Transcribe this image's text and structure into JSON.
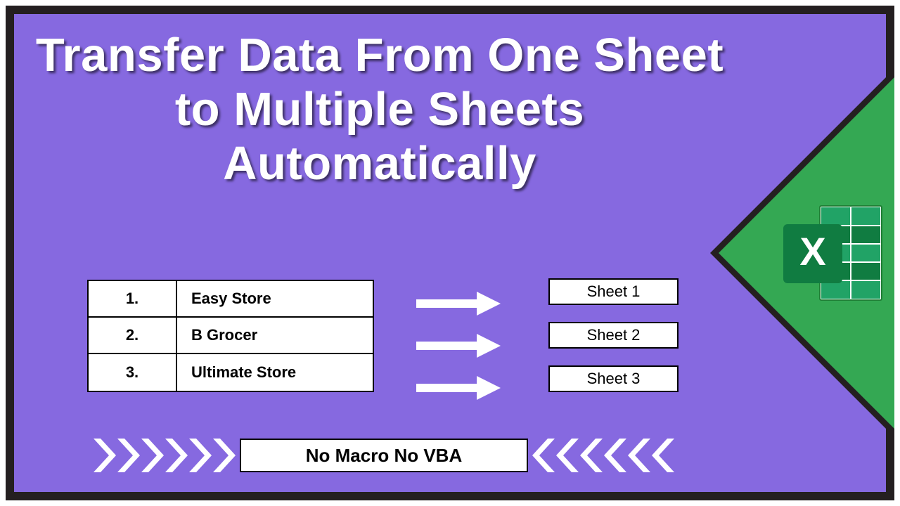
{
  "title": "Transfer Data From One Sheet to Multiple Sheets Automatically",
  "stores": [
    {
      "num": "1.",
      "name": "Easy Store"
    },
    {
      "num": "2.",
      "name": "B Grocer"
    },
    {
      "num": "3.",
      "name": "Ultimate Store"
    }
  ],
  "sheets": [
    "Sheet 1",
    "Sheet 2",
    "Sheet 3"
  ],
  "ribbon": "No Macro No VBA",
  "icons": {
    "excel_letter": "X"
  }
}
